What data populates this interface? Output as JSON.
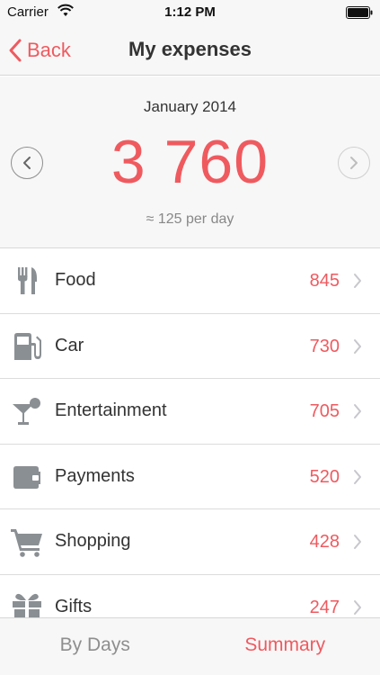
{
  "status_bar": {
    "carrier": "Carrier",
    "time": "1:12 PM"
  },
  "nav": {
    "back_label": "Back",
    "title": "My expenses"
  },
  "summary": {
    "period": "January 2014",
    "total": "3 760",
    "per_day": "≈ 125 per day"
  },
  "categories": [
    {
      "label": "Food",
      "amount": "845",
      "icon": "fork-knife-icon"
    },
    {
      "label": "Car",
      "amount": "730",
      "icon": "fuel-pump-icon"
    },
    {
      "label": "Entertainment",
      "amount": "705",
      "icon": "cocktail-icon"
    },
    {
      "label": "Payments",
      "amount": "520",
      "icon": "wallet-icon"
    },
    {
      "label": "Shopping",
      "amount": "428",
      "icon": "shopping-cart-icon"
    },
    {
      "label": "Gifts",
      "amount": "247",
      "icon": "gift-icon"
    }
  ],
  "tabs": {
    "by_days": "By Days",
    "summary": "Summary"
  },
  "colors": {
    "accent": "#ef5a5f",
    "icon_gray": "#8a8f93",
    "background": "#f7f7f7"
  }
}
